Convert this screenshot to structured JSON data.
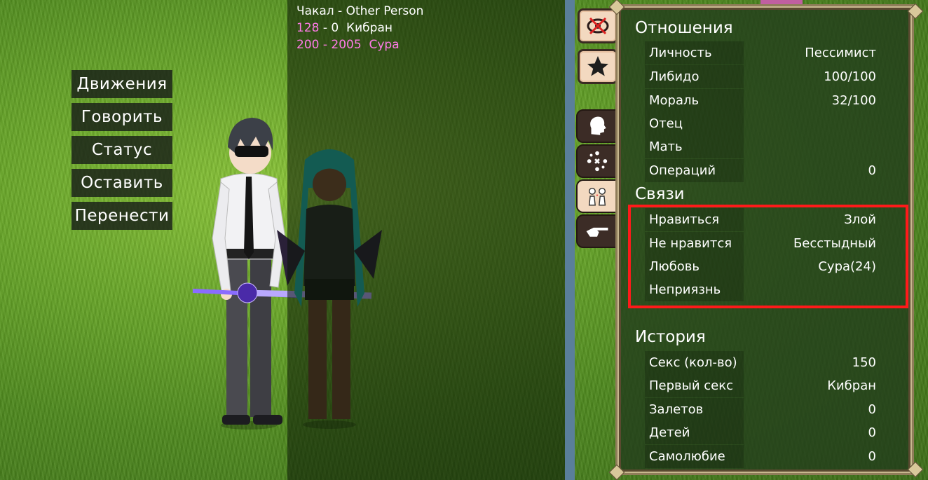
{
  "menu": {
    "items": [
      "Движения",
      "Говорить",
      "Статус",
      "Оставить",
      "Перенести"
    ]
  },
  "info": {
    "title": "Чакал - Other Person",
    "line1": {
      "a": "128",
      "sep": " - ",
      "b": "0",
      "name": "Кибран"
    },
    "line2": {
      "a": "200",
      "sep": " - ",
      "b": "2005",
      "name": "Сура"
    }
  },
  "icons": {
    "top": [
      "hidden-eye-icon",
      "star-icon"
    ],
    "tabs": [
      "head-profile-icon",
      "dots-cross-icon",
      "couple-icon",
      "pointing-hand-icon"
    ]
  },
  "relations": {
    "title": "Отношения",
    "rows": [
      {
        "label": "Личность",
        "value": "Пессимист"
      },
      {
        "label": "Либидо",
        "value": "100/100"
      },
      {
        "label": "Мораль",
        "value": "32/100"
      },
      {
        "label": "Отец",
        "value": ""
      },
      {
        "label": "Мать",
        "value": ""
      },
      {
        "label": "Операций",
        "value": "0"
      }
    ]
  },
  "links": {
    "title": "Связи",
    "rows": [
      {
        "label": "Нравиться",
        "value": "Злой"
      },
      {
        "label": "Не нравится",
        "value": "Бесстыдный"
      },
      {
        "label": "Любовь",
        "value": "Сура(24)"
      },
      {
        "label": "Неприязнь",
        "value": ""
      }
    ]
  },
  "history": {
    "title": "История",
    "rows": [
      {
        "label": "Секс (кол-во)",
        "value": "150"
      },
      {
        "label": "Первый секс",
        "value": "Кибран"
      },
      {
        "label": "Залетов",
        "value": "0"
      },
      {
        "label": "Детей",
        "value": "0"
      },
      {
        "label": "Самолюбие",
        "value": "0"
      }
    ]
  },
  "colors": {
    "highlight": "#ff1a1a",
    "pink_text": "#ff7ae8",
    "panel_border": "#8f7d5a"
  }
}
